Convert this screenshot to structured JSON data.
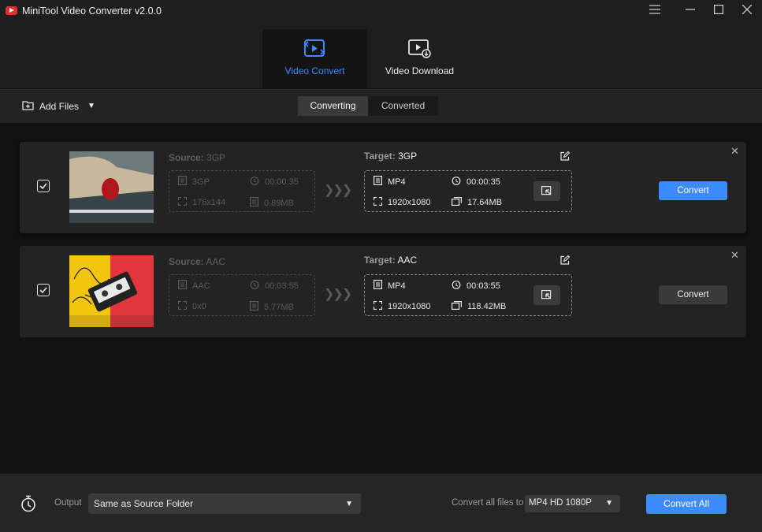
{
  "app": {
    "title": "MiniTool Video Converter v2.0.0"
  },
  "nav": {
    "tabs": [
      {
        "label": "Video Convert",
        "active": true
      },
      {
        "label": "Video Download",
        "active": false
      }
    ]
  },
  "toolbar": {
    "add_files_label": "Add Files",
    "segments": [
      {
        "label": "Converting",
        "active": true
      },
      {
        "label": "Converted",
        "active": false
      }
    ]
  },
  "files": [
    {
      "checked": true,
      "source_label": "Source:",
      "source_format": "3GP",
      "source": {
        "format": "3GP",
        "duration": "00:00:35",
        "resolution": "176x144",
        "size": "0.89MB"
      },
      "target_label": "Target:",
      "target_format": "3GP",
      "target": {
        "format": "MP4",
        "duration": "00:00:35",
        "resolution": "1920x1080",
        "size": "17.64MB"
      },
      "convert_label": "Convert",
      "convert_style": "primary"
    },
    {
      "checked": true,
      "source_label": "Source:",
      "source_format": "AAC",
      "source": {
        "format": "AAC",
        "duration": "00:03:55",
        "resolution": "0x0",
        "size": "5.77MB"
      },
      "target_label": "Target:",
      "target_format": "AAC",
      "target": {
        "format": "MP4",
        "duration": "00:03:55",
        "resolution": "1920x1080",
        "size": "118.42MB"
      },
      "convert_label": "Convert",
      "convert_style": "secondary"
    }
  ],
  "bottom": {
    "output_label": "Output",
    "output_value": "Same as Source Folder",
    "convert_all_files_to_label": "Convert all files to",
    "format_value": "MP4 HD 1080P",
    "convert_all_label": "Convert All"
  },
  "colors": {
    "accent": "#3d8bff",
    "background": "#121212",
    "card": "#232323",
    "logo": "#e0312f"
  }
}
